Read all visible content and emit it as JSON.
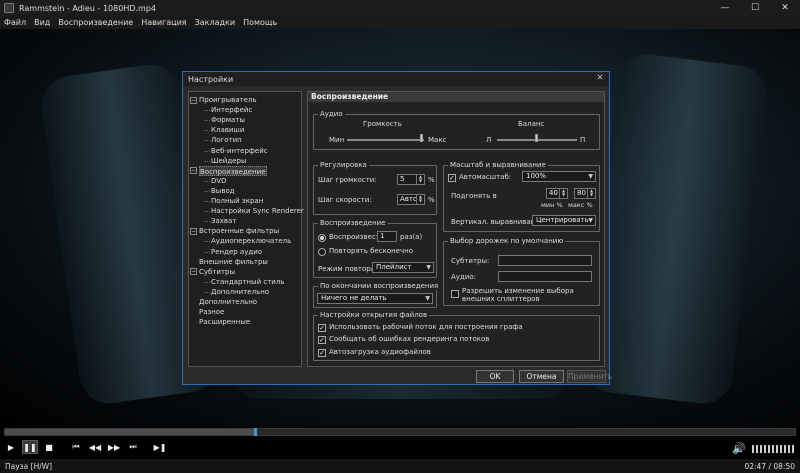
{
  "window": {
    "title": "Rammstein - Adieu - 1080HD.mp4",
    "buttons": {
      "minimize": "—",
      "maximize": "☐",
      "close": "✕"
    }
  },
  "menu": [
    "Файл",
    "Вид",
    "Воспроизведение",
    "Навигация",
    "Закладки",
    "Помощь"
  ],
  "player": {
    "progress_fraction": 0.316,
    "volume_level": 1.0,
    "status_left": "Пауза [H/W]",
    "status_right": "02:47 / 08:50"
  },
  "dialog": {
    "title": "Настройки",
    "close": "✕",
    "tree": [
      {
        "label": "Проигрыватель",
        "level": 0,
        "expander": "−"
      },
      {
        "label": "Интерфейс",
        "level": 1
      },
      {
        "label": "Форматы",
        "level": 1
      },
      {
        "label": "Клавиши",
        "level": 1
      },
      {
        "label": "Логотип",
        "level": 1
      },
      {
        "label": "Веб-интерфейс",
        "level": 1
      },
      {
        "label": "Шейдеры",
        "level": 1
      },
      {
        "label": "Воспроизведение",
        "level": 0,
        "expander": "−",
        "selected": true
      },
      {
        "label": "DVD",
        "level": 1
      },
      {
        "label": "Вывод",
        "level": 1
      },
      {
        "label": "Полный экран",
        "level": 1
      },
      {
        "label": "Настройки Sync Renderer",
        "level": 1
      },
      {
        "label": "Захват",
        "level": 1
      },
      {
        "label": "Встроенные фильтры",
        "level": 0,
        "expander": "−"
      },
      {
        "label": "Аудиопереключатель",
        "level": 1
      },
      {
        "label": "Рендер аудио",
        "level": 1
      },
      {
        "label": "Внешние фильтры",
        "level": 0
      },
      {
        "label": "Субтитры",
        "level": 0,
        "expander": "−"
      },
      {
        "label": "Стандартный стиль",
        "level": 1
      },
      {
        "label": "Дополнительно",
        "level": 1
      },
      {
        "label": "Дополнительно",
        "level": 0
      },
      {
        "label": "Разное",
        "level": 0
      },
      {
        "label": "Расширенные",
        "level": 0
      }
    ],
    "panel": {
      "heading": "Воспроизведение",
      "audio": {
        "group": "Аудио",
        "volume_label": "Громкость",
        "balance_label": "Баланс",
        "min": "Мин",
        "max": "Макс",
        "left": "Л",
        "right": "П"
      },
      "regulation": {
        "group": "Регулировка",
        "volume_step_label": "Шаг громкости:",
        "volume_step": "5",
        "volume_step_unit": "%",
        "speed_step_label": "Шаг скорости:",
        "speed_step": "Авто",
        "speed_step_unit": "%"
      },
      "playback": {
        "group": "Воспроизведение",
        "play_label": "Воспроизвести",
        "play_count": "1",
        "times": "раз(а)",
        "repeat_forever": "Повторять бесконечно",
        "repeat_mode_label": "Режим повтора:",
        "repeat_mode": "Плейлист"
      },
      "after": {
        "group": "По окончании воспроизведения",
        "value": "Ничего не делать"
      },
      "scale": {
        "group": "Масштаб и выравнивание",
        "autoscale_label": "Автомасштаб:",
        "autoscale_value": "100%",
        "fit_label": "Подгонять в",
        "min_value": "40",
        "max_value": "80",
        "min_label": "мин %",
        "max_label": "макс %",
        "valign_label": "Вертикал. выравнивание:",
        "valign_value": "Центрировать"
      },
      "tracks": {
        "group": "Выбор дорожек по умолчанию",
        "subtitles_label": "Субтитры:",
        "audio_label": "Аудио:",
        "external_label": "Разрешить изменение выбора внешних сплиттеров"
      },
      "open": {
        "group": "Настройки открытия файлов",
        "opt1": "Использовать рабочий поток для построения графа",
        "opt2": "Сообщать об ошибках рендеринга потоков",
        "opt3": "Автозагрузка аудиофайлов"
      }
    },
    "buttons": {
      "ok": "OK",
      "cancel": "Отмена",
      "apply": "Применить"
    }
  },
  "colors": {
    "accent": "#2f6fb3",
    "seek_thumb": "#2fa0c8",
    "background": "#000000"
  }
}
